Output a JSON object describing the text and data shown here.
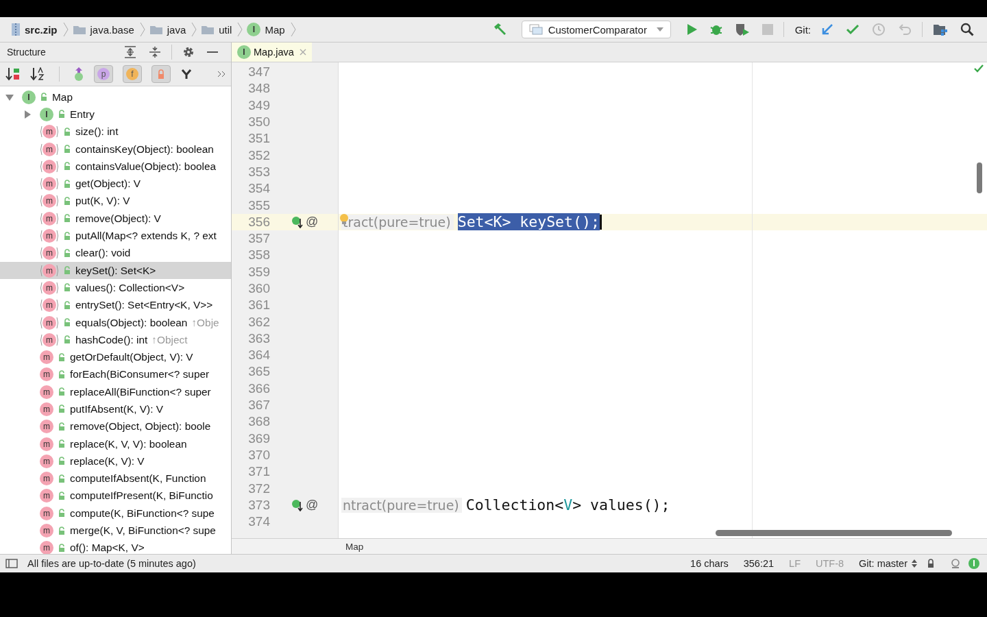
{
  "breadcrumbs": [
    {
      "label": "src.zip",
      "kind": "archive"
    },
    {
      "label": "java.base",
      "kind": "folder"
    },
    {
      "label": "java",
      "kind": "folder"
    },
    {
      "label": "util",
      "kind": "folder"
    },
    {
      "label": "Map",
      "kind": "interface",
      "badge": "I"
    }
  ],
  "toolbar": {
    "run_config": "CustomerComparator",
    "git_label": "Git:"
  },
  "structure": {
    "title": "Structure",
    "filters": [
      {
        "kind": "letter",
        "label": "p",
        "on": true,
        "color": "#c9a6e8"
      },
      {
        "kind": "letter",
        "label": "f",
        "on": true,
        "color": "#f0b45a"
      },
      {
        "kind": "lock",
        "on": true,
        "color": "#f08a6a"
      }
    ],
    "tree": {
      "label": "Map",
      "kind": "interface",
      "badge": "I",
      "expanded": true,
      "selected": false,
      "children": [
        {
          "label": "Entry",
          "kind": "interface",
          "badge": "I",
          "expanded": false,
          "selected": false
        },
        {
          "label": "size(): int",
          "kind": "method",
          "badge": "m",
          "abstract": true,
          "selected": false
        },
        {
          "label": "containsKey(Object): boolean",
          "kind": "method",
          "badge": "m",
          "abstract": true,
          "selected": false
        },
        {
          "label": "containsValue(Object): boolea",
          "kind": "method",
          "badge": "m",
          "abstract": true,
          "selected": false
        },
        {
          "label": "get(Object): V",
          "kind": "method",
          "badge": "m",
          "abstract": true,
          "selected": false
        },
        {
          "label": "put(K, V): V",
          "kind": "method",
          "badge": "m",
          "abstract": true,
          "selected": false
        },
        {
          "label": "remove(Object): V",
          "kind": "method",
          "badge": "m",
          "abstract": true,
          "selected": false
        },
        {
          "label": "putAll(Map<? extends K, ? ext",
          "kind": "method",
          "badge": "m",
          "abstract": true,
          "selected": false
        },
        {
          "label": "clear(): void",
          "kind": "method",
          "badge": "m",
          "abstract": true,
          "selected": false
        },
        {
          "label": "keySet(): Set<K>",
          "kind": "method",
          "badge": "m",
          "abstract": true,
          "selected": true
        },
        {
          "label": "values(): Collection<V>",
          "kind": "method",
          "badge": "m",
          "abstract": true,
          "selected": false
        },
        {
          "label": "entrySet(): Set<Entry<K, V>>",
          "kind": "method",
          "badge": "m",
          "abstract": true,
          "selected": false
        },
        {
          "label": "equals(Object): boolean",
          "inherited": "↑Obje",
          "kind": "method",
          "badge": "m",
          "abstract": true,
          "selected": false
        },
        {
          "label": "hashCode(): int",
          "inherited": "↑Object",
          "kind": "method",
          "badge": "m",
          "abstract": true,
          "selected": false
        },
        {
          "label": "getOrDefault(Object, V): V",
          "kind": "method",
          "badge": "m",
          "abstract": false,
          "selected": false
        },
        {
          "label": "forEach(BiConsumer<? super",
          "kind": "method",
          "badge": "m",
          "abstract": false,
          "selected": false
        },
        {
          "label": "replaceAll(BiFunction<? super",
          "kind": "method",
          "badge": "m",
          "abstract": false,
          "selected": false
        },
        {
          "label": "putIfAbsent(K, V): V",
          "kind": "method",
          "badge": "m",
          "abstract": false,
          "selected": false
        },
        {
          "label": "remove(Object, Object): boole",
          "kind": "method",
          "badge": "m",
          "abstract": false,
          "selected": false
        },
        {
          "label": "replace(K, V, V): boolean",
          "kind": "method",
          "badge": "m",
          "abstract": false,
          "selected": false
        },
        {
          "label": "replace(K, V): V",
          "kind": "method",
          "badge": "m",
          "abstract": false,
          "selected": false
        },
        {
          "label": "computeIfAbsent(K, Function",
          "kind": "method",
          "badge": "m",
          "abstract": false,
          "selected": false
        },
        {
          "label": "computeIfPresent(K, BiFunctio",
          "kind": "method",
          "badge": "m",
          "abstract": false,
          "selected": false
        },
        {
          "label": "compute(K, BiFunction<? supe",
          "kind": "method",
          "badge": "m",
          "abstract": false,
          "selected": false
        },
        {
          "label": "merge(K, V, BiFunction<? supe",
          "kind": "method",
          "badge": "m",
          "abstract": false,
          "selected": false
        },
        {
          "label": "of(): Map<K, V>",
          "kind": "method",
          "badge": "m",
          "abstract": false,
          "selected": false
        }
      ]
    }
  },
  "editor": {
    "tab": {
      "label": "Map.java",
      "badge": "I",
      "selected": true
    },
    "lines": [
      {
        "number": "347"
      },
      {
        "number": "348"
      },
      {
        "number": "349"
      },
      {
        "number": "350"
      },
      {
        "number": "351"
      },
      {
        "number": "352"
      },
      {
        "number": "353"
      },
      {
        "number": "354"
      },
      {
        "number": "355"
      },
      {
        "number": "356",
        "current": true,
        "marker": "@",
        "folded": "tract(pure=true)",
        "tokens": [
          {
            "text": "Set<K> keySet();",
            "kind": "plain",
            "selected": true
          }
        ]
      },
      {
        "number": "357"
      },
      {
        "number": "358"
      },
      {
        "number": "359"
      },
      {
        "number": "360"
      },
      {
        "number": "361"
      },
      {
        "number": "362"
      },
      {
        "number": "363"
      },
      {
        "number": "364"
      },
      {
        "number": "365"
      },
      {
        "number": "366"
      },
      {
        "number": "367"
      },
      {
        "number": "368"
      },
      {
        "number": "369"
      },
      {
        "number": "370"
      },
      {
        "number": "371"
      },
      {
        "number": "372"
      },
      {
        "number": "373",
        "current": false,
        "marker": "@",
        "folded": "ntract(pure=true)",
        "tokens": [
          {
            "text": "Collection<",
            "kind": "plain",
            "selected": false
          },
          {
            "text": "V",
            "kind": "type_param",
            "selected": false
          },
          {
            "text": "> values();",
            "kind": "plain",
            "selected": false
          }
        ]
      },
      {
        "number": "374"
      }
    ],
    "breadcrumb": "Map"
  },
  "status_bar": {
    "message": "All files are up-to-date (5 minutes ago)",
    "chars": "16 chars",
    "position": "356:21",
    "line_separator": "LF",
    "encoding": "UTF-8",
    "vcs": "Git: master"
  }
}
